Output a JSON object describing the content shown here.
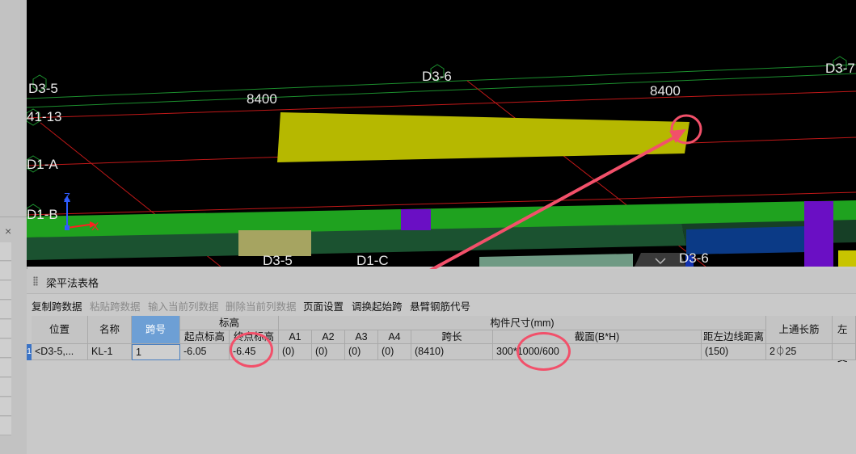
{
  "viewport": {
    "axis_labels": [
      "D3-5",
      "D3-6",
      "D3-7",
      "41-13",
      "D1-A",
      "D1-B",
      "D3-5",
      "D1-C",
      "D3-6"
    ],
    "dimension_labels": [
      "8400",
      "8400"
    ],
    "ucs": {
      "z": "Z",
      "x": "X"
    },
    "colors": {
      "background": "#000000",
      "beam_selected": "#b6b800",
      "beam_green": "#1fa21f",
      "beam_dark_green": "#1b5230",
      "column_purple": "#6a0fc4",
      "annotation": "#f2506a"
    }
  },
  "left_panel": {
    "close_glyph": "×"
  },
  "panel": {
    "title": "梁平法表格",
    "toolbar": [
      {
        "label": "复制跨数据",
        "enabled": true
      },
      {
        "label": "粘贴跨数据",
        "enabled": false
      },
      {
        "label": "输入当前列数据",
        "enabled": false
      },
      {
        "label": "删除当前列数据",
        "enabled": false
      },
      {
        "label": "页面设置",
        "enabled": true
      },
      {
        "label": "调换起始跨",
        "enabled": true
      },
      {
        "label": "悬臂钢筋代号",
        "enabled": true
      }
    ],
    "table": {
      "headers": {
        "position": "位置",
        "name": "名称",
        "span_no": "跨号",
        "elevation_group": "标高",
        "start_elev": "起点标高",
        "end_elev": "终点标高",
        "size_group": "构件尺寸(mm)",
        "a1": "A1",
        "a2": "A2",
        "a3": "A3",
        "a4": "A4",
        "span_len": "跨长",
        "section": "截面(B*H)",
        "left_dist": "距左边线距离",
        "top_through": "上通长筋",
        "left_support": "左支"
      },
      "row": {
        "index": "1",
        "position": "<D3-5,...",
        "name": "KL-1",
        "span_no": "1",
        "start_elev": "-6.05",
        "end_elev": "-6.45",
        "a1": "(0)",
        "a2": "(0)",
        "a3": "(0)",
        "a4": "(0)",
        "span_len": "(8410)",
        "section": "300*1000/600",
        "left_dist": "(150)",
        "top_through": "2⏀25"
      }
    }
  }
}
